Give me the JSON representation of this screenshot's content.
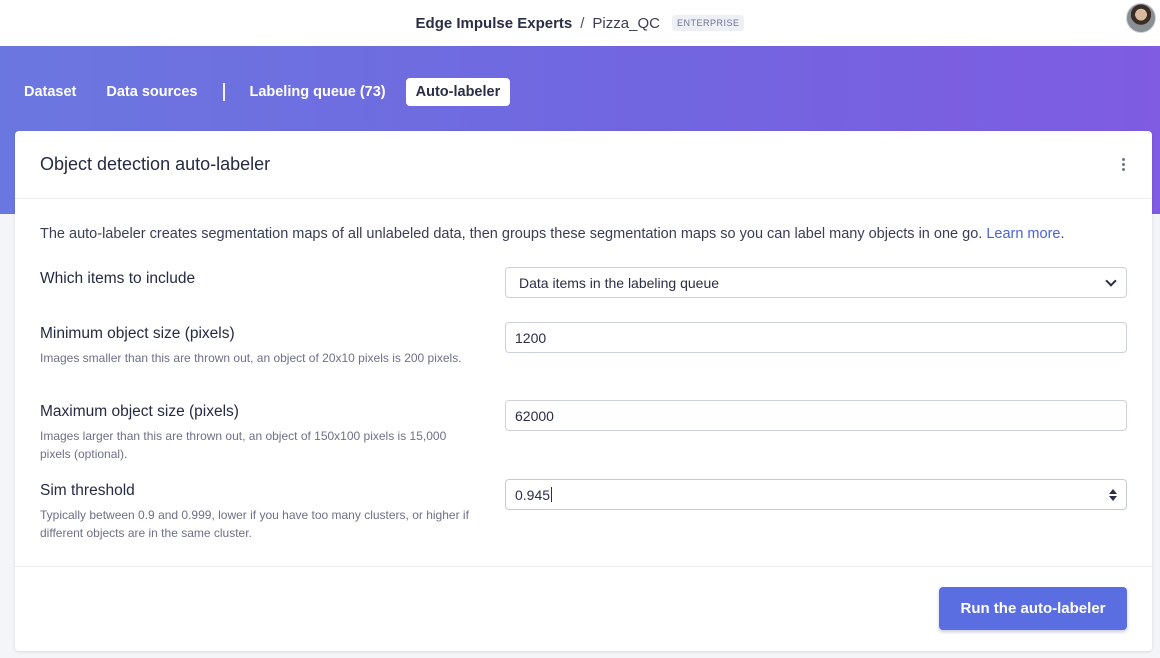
{
  "topbar": {
    "organization": "Edge Impulse Experts",
    "separator": "/",
    "project": "Pizza_QC",
    "plan_badge": "ENTERPRISE",
    "avatar_icon": "user-avatar"
  },
  "tabs": [
    {
      "label": "Dataset",
      "active": false
    },
    {
      "label": "Data sources",
      "active": false
    },
    {
      "label": "Labeling queue (73)",
      "active": false
    },
    {
      "label": "Auto-labeler",
      "active": true
    }
  ],
  "card": {
    "title": "Object detection auto-labeler",
    "menu_icon": "kebab-menu-icon",
    "intro": "The auto-labeler creates segmentation maps of all unlabeled data, then groups these segmentation maps so you can label many objects in one go.",
    "learn_more": "Learn more",
    "intro_end": "."
  },
  "form": {
    "include": {
      "label": "Which items to include",
      "value": "Data items in the labeling queue"
    },
    "min_size": {
      "label": "Minimum object size (pixels)",
      "help": "Images smaller than this are thrown out, an object of 20x10 pixels is 200 pixels.",
      "value": "1200"
    },
    "max_size": {
      "label": "Maximum object size (pixels)",
      "help": "Images larger than this are thrown out, an object of 150x100 pixels is 15,000 pixels (optional).",
      "value": "62000"
    },
    "sim_threshold": {
      "label": "Sim threshold",
      "help": "Typically between 0.9 and 0.999, lower if you have too many clusters, or higher if different objects are in the same cluster.",
      "value": "0.945"
    }
  },
  "footer": {
    "run_label": "Run the auto-labeler"
  },
  "colors": {
    "accent": "#5b6ee1",
    "banner_start": "#6b77e0",
    "banner_end": "#7f5ce2",
    "link": "#4a62d8"
  }
}
